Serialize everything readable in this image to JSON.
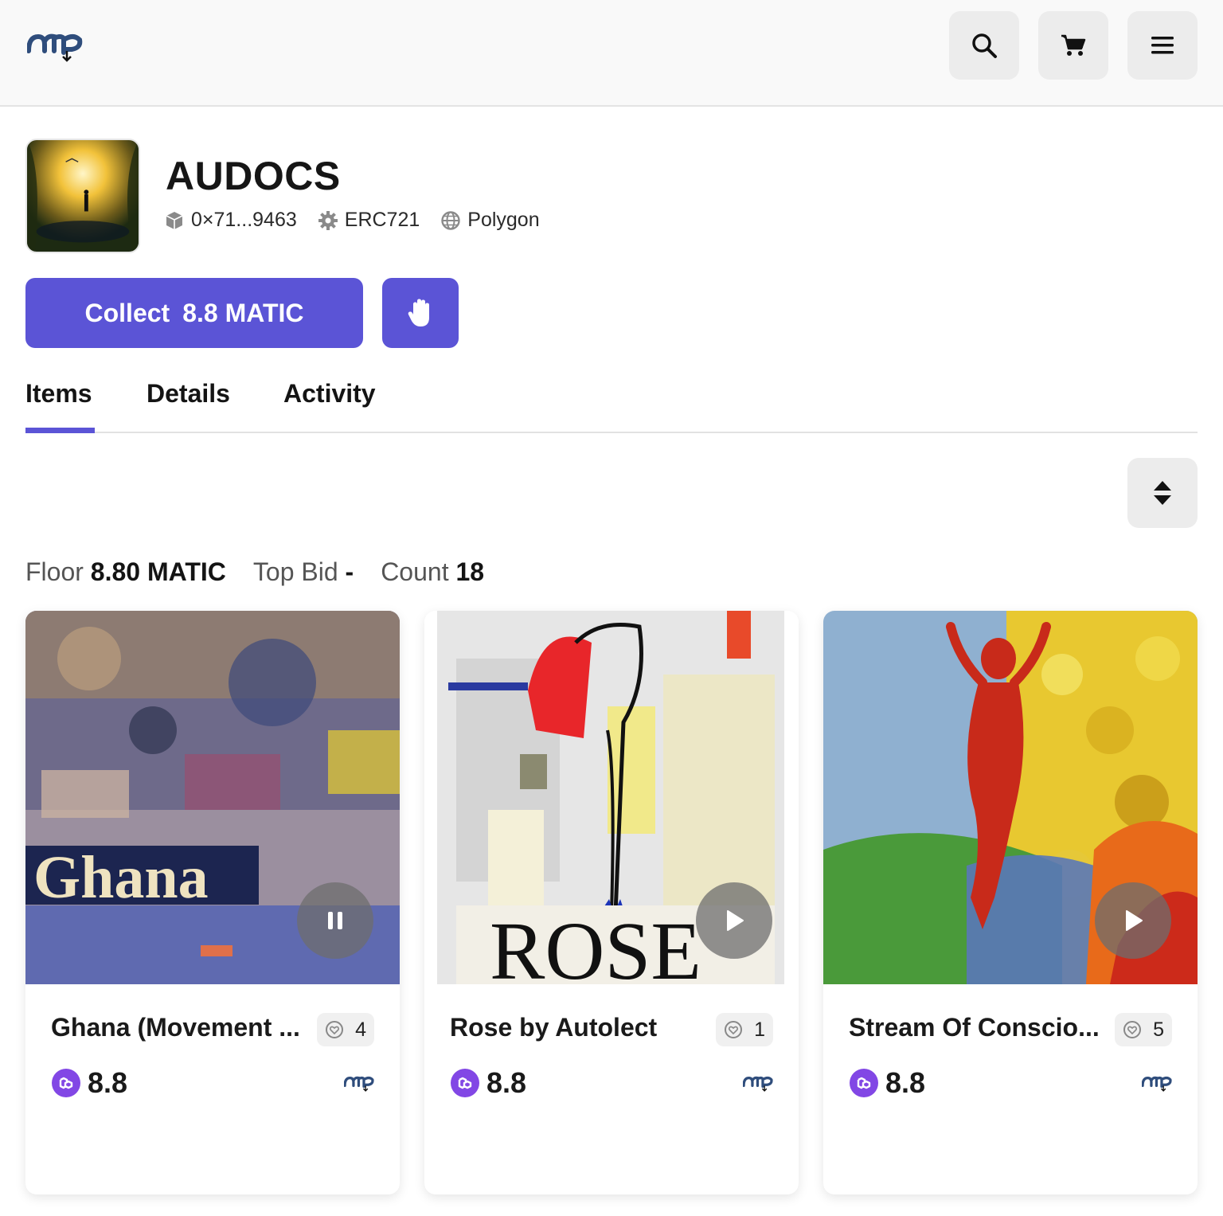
{
  "header": {
    "logo_icon": "nup-logo-icon",
    "buttons": [
      {
        "name": "search",
        "icon": "search-icon"
      },
      {
        "name": "cart",
        "icon": "cart-icon"
      },
      {
        "name": "menu",
        "icon": "hamburger-menu-icon"
      }
    ]
  },
  "collection": {
    "name": "AUDOCS",
    "contract": "0×71...9463",
    "standard": "ERC721",
    "network": "Polygon"
  },
  "actions": {
    "collect_label": "Collect",
    "collect_price": "8.8 MATIC",
    "bid_icon": "hand-icon"
  },
  "tabs": [
    {
      "label": "Items",
      "active": true
    },
    {
      "label": "Details",
      "active": false
    },
    {
      "label": "Activity",
      "active": false
    }
  ],
  "stats": {
    "floor_label": "Floor",
    "floor_value": "8.80 MATIC",
    "top_bid_label": "Top Bid",
    "top_bid_value": "-",
    "count_label": "Count",
    "count_value": "18"
  },
  "items": [
    {
      "name": "Ghana (Movement ...",
      "likes": "4",
      "price": "8.8",
      "player_state": "playing",
      "player_icon": "pause-icon",
      "art_text": "Ghana"
    },
    {
      "name": "Rose by Autolect",
      "likes": "1",
      "price": "8.8",
      "player_state": "paused",
      "player_icon": "play-icon",
      "art_text": "ROSE"
    },
    {
      "name": "Stream Of Conscio...",
      "likes": "5",
      "price": "8.8",
      "player_state": "paused",
      "player_icon": "play-icon",
      "art_text": ""
    }
  ],
  "colors": {
    "accent": "#5b54d6",
    "polygon": "#8247e5",
    "header_bg": "#f9f9f9",
    "button_bg": "#ececec"
  }
}
